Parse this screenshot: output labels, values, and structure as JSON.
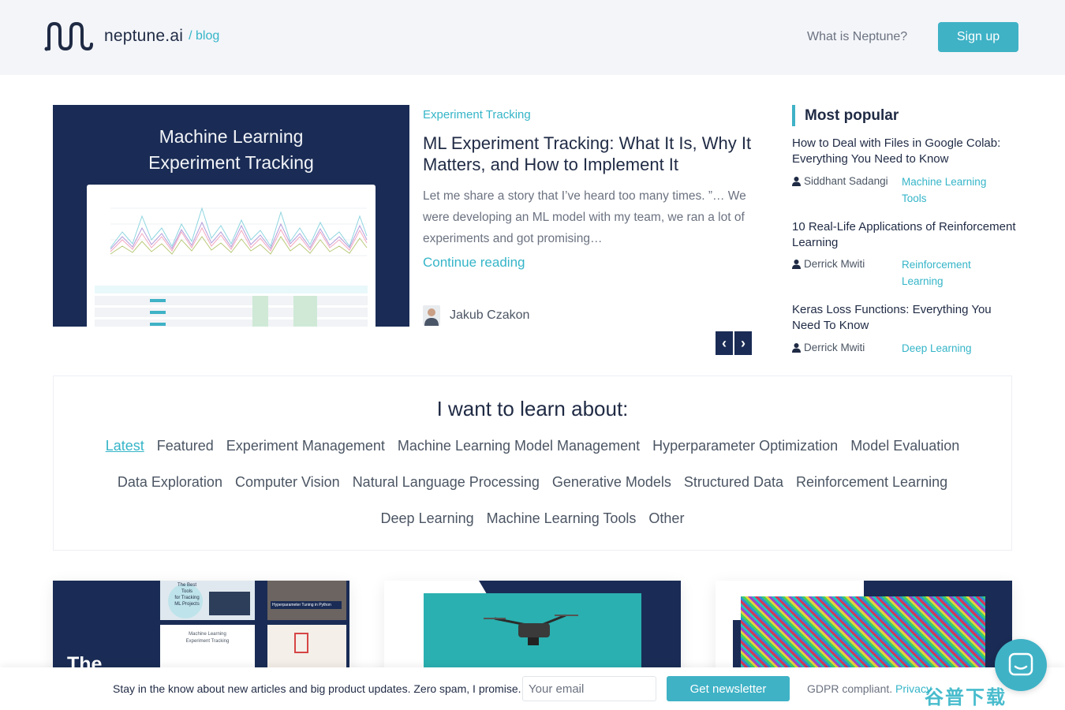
{
  "header": {
    "logo_name": "neptune.ai",
    "logo_blog": "/ blog",
    "nav_link": "What is Neptune?",
    "signup": "Sign up"
  },
  "featured": {
    "image_title_line1": "Machine Learning",
    "image_title_line2": "Experiment Tracking",
    "category": "Experiment Tracking",
    "title": "ML Experiment Tracking: What It Is, Why It Matters, and How to Implement It",
    "excerpt": "Let me share a story that I’ve heard too many times. ”… We were developing an ML model with my team, we ran a lot of experiments and got promising…",
    "continue": "Continue reading",
    "author": "Jakub Czakon",
    "prev_icon": "‹",
    "next_icon": "›"
  },
  "popular": {
    "heading": "Most popular",
    "items": [
      {
        "title": "How to Deal with Files in Google Colab: Everything You Need to Know",
        "author": "Siddhant Sadangi",
        "tag": "Machine Learning Tools"
      },
      {
        "title": "10 Real-Life Applications of Reinforcement Learning",
        "author": "Derrick Mwiti",
        "tag": "Reinforcement Learning"
      },
      {
        "title": "Keras Loss Functions: Everything You Need To Know",
        "author": "Derrick Mwiti",
        "tag": "Deep Learning"
      }
    ]
  },
  "learn": {
    "title": "I want to learn about:",
    "row1": [
      "Latest",
      "Featured",
      "Experiment Management",
      "Machine Learning Model Management",
      "Hyperparameter Optimization",
      "Model Evaluation"
    ],
    "row2": [
      "Data Exploration",
      "Computer Vision",
      "Natural Language Processing",
      "Generative Models",
      "Structured Data",
      "Reinforcement Learning"
    ],
    "row3": [
      "Deep Learning",
      "Machine Learning Tools",
      "Other"
    ]
  },
  "cards": {
    "card1_big": "The",
    "card1_thumb1_a": "The Best",
    "card1_thumb1_b": "Tools",
    "card1_thumb1_c": "for Tracking",
    "card1_thumb1_d": "ML Projects",
    "card1_thumb2": "Hyperparameter Tuning in Python",
    "card1_thumb3_a": "Machine Learning",
    "card1_thumb3_b": "Experiment Tracking"
  },
  "newsletter": {
    "text": "Stay in the know about new articles and big product updates. Zero spam, I promise.",
    "placeholder": "Your email",
    "button": "Get newsletter",
    "gdpr": "GDPR compliant.",
    "privacy": "Privacy"
  },
  "watermark": "谷普下载",
  "colors": {
    "accent": "#3fb2c6",
    "navy": "#1a2c55",
    "text": "#1f2a44"
  }
}
